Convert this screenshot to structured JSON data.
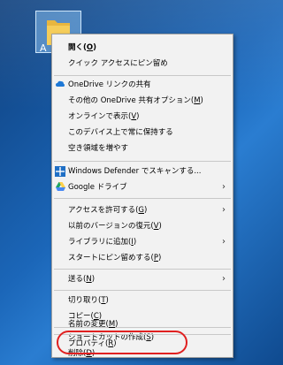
{
  "desktop": {
    "folder_label": "A"
  },
  "menu": {
    "open": {
      "text": "開く(",
      "key": "O",
      "end": ")"
    },
    "pin_quick_access": {
      "text": "クイック アクセスにピン留め"
    },
    "onedrive_share": {
      "text": "OneDrive リンクの共有"
    },
    "onedrive_other": {
      "text": "その他の OneDrive 共有オプション(",
      "key": "M",
      "end": ")"
    },
    "show_online": {
      "text": "オンラインで表示(",
      "key": "V",
      "end": ")"
    },
    "keep_on_device": {
      "text": "このデバイス上で常に保持する"
    },
    "free_space": {
      "text": "空き領域を増やす"
    },
    "defender_scan": {
      "text": "Windows Defender でスキャンする..."
    },
    "google_drive": {
      "text": "Google ドライブ"
    },
    "give_access": {
      "text": "アクセスを許可する(",
      "key": "G",
      "end": ")"
    },
    "restore_versions": {
      "text": "以前のバージョンの復元(",
      "key": "V",
      "end": ")"
    },
    "add_to_library": {
      "text": "ライブラリに追加(",
      "key": "I",
      "end": ")"
    },
    "pin_start": {
      "text": "スタートにピン留めする(",
      "key": "P",
      "end": ")"
    },
    "send_to": {
      "text": "送る(",
      "key": "N",
      "end": ")"
    },
    "cut": {
      "text": "切り取り(",
      "key": "T",
      "end": ")"
    },
    "copy": {
      "text": "コピー(",
      "key": "C",
      "end": ")"
    },
    "create_shortcut": {
      "text": "ショートカットの作成(",
      "key": "S",
      "end": ")"
    },
    "delete": {
      "text": "削除(",
      "key": "D",
      "end": ")"
    },
    "rename": {
      "text": "名前の変更(",
      "key": "M",
      "end": ")"
    },
    "properties": {
      "text": "プロパティ(",
      "key": "R",
      "end": ")"
    }
  },
  "colors": {
    "highlight_ring": "#e02020",
    "menu_bg": "#f2f2f2"
  }
}
